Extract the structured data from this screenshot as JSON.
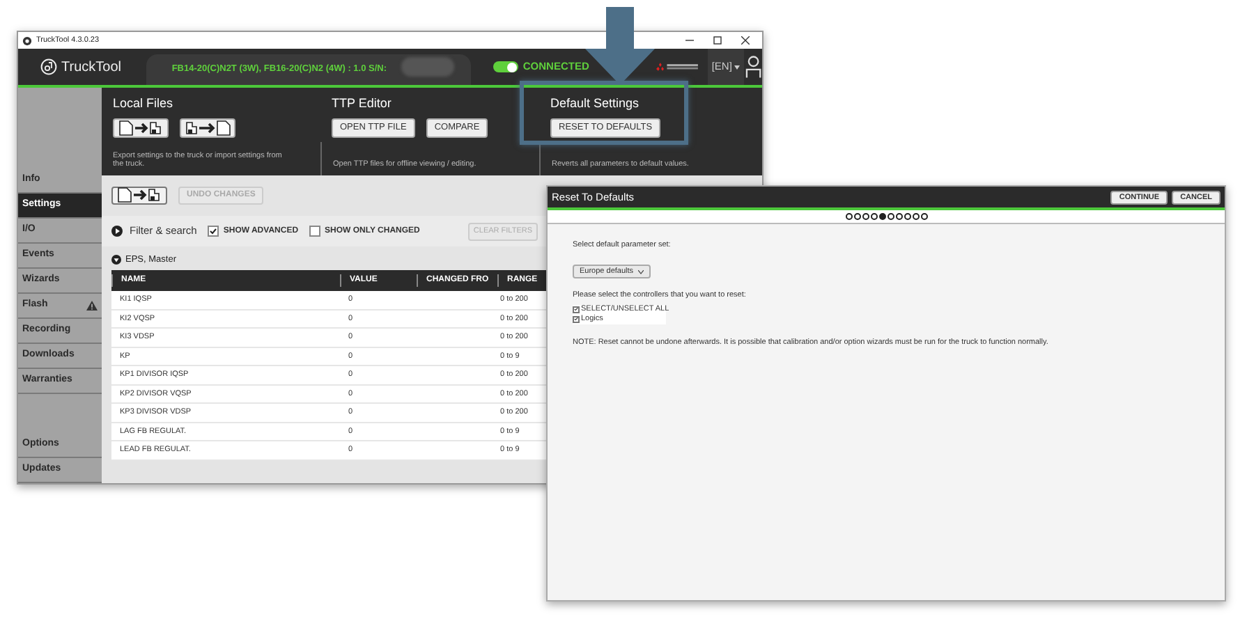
{
  "window": {
    "title": "TruckTool 4.3.0.23"
  },
  "header": {
    "app_name": "TruckTool",
    "model": "FB14-20(C)N2T (3W), FB16-20(C)N2 (4W) : 1.0  S/N:",
    "connection": {
      "on": true,
      "label": "CONNECTED"
    },
    "language": "[EN]"
  },
  "toolbar": {
    "sections": [
      {
        "title": "Local Files",
        "kind": "icons",
        "description": "Export settings to the truck or import settings from the truck.",
        "highlighted": false
      },
      {
        "title": "TTP Editor",
        "kind": "buttons",
        "buttons": [
          "OPEN TTP FILE",
          "COMPARE"
        ],
        "description": "Open TTP files for offline viewing / editing.",
        "highlighted": false
      },
      {
        "title": "Default Settings",
        "kind": "buttons",
        "buttons": [
          "RESET TO DEFAULTS"
        ],
        "description": "Reverts all parameters to default values.",
        "highlighted": true
      }
    ]
  },
  "sidebar": {
    "items": [
      {
        "label": "Info",
        "selected": false,
        "warning": false
      },
      {
        "label": "Settings",
        "selected": true,
        "warning": false
      },
      {
        "label": "I/O",
        "selected": false,
        "warning": false
      },
      {
        "label": "Events",
        "selected": false,
        "warning": false
      },
      {
        "label": "Wizards",
        "selected": false,
        "warning": false
      },
      {
        "label": "Flash",
        "selected": false,
        "warning": true
      },
      {
        "label": "Recording",
        "selected": false,
        "warning": false
      },
      {
        "label": "Downloads",
        "selected": false,
        "warning": false
      },
      {
        "label": "Warranties",
        "selected": false,
        "warning": false
      }
    ],
    "bottom_items": [
      {
        "label": "Options",
        "selected": false,
        "warning": false
      },
      {
        "label": "Updates",
        "selected": false,
        "warning": false
      }
    ]
  },
  "settings": {
    "undo_button": {
      "label": "UNDO CHANGES",
      "disabled": true
    },
    "filter": {
      "label": "Filter & search",
      "options": [
        {
          "label": "SHOW ADVANCED",
          "checked": true
        },
        {
          "label": "SHOW ONLY CHANGED",
          "checked": false
        }
      ],
      "clear_button": {
        "label": "CLEAR FILTERS",
        "disabled": true
      }
    },
    "group": {
      "title": "EPS, Master",
      "expanded": true
    },
    "table": {
      "columns": [
        "NAME",
        "VALUE",
        "CHANGED FRO",
        "RANGE"
      ],
      "rows": [
        {
          "name": "KI1  IQSP",
          "value": "0",
          "range": "0 to 200"
        },
        {
          "name": "KI2  VQSP",
          "value": "0",
          "range": "0 to 200"
        },
        {
          "name": "KI3  VDSP",
          "value": "0",
          "range": "0 to 200"
        },
        {
          "name": "KP",
          "value": "0",
          "range": "0 to 9"
        },
        {
          "name": "KP1 DIVISOR IQSP",
          "value": "0",
          "range": "0 to 200"
        },
        {
          "name": "KP2 DIVISOR VQSP",
          "value": "0",
          "range": "0 to 200"
        },
        {
          "name": "KP3 DIVISOR VDSP",
          "value": "0",
          "range": "0 to 200"
        },
        {
          "name": "LAG FB REGULAT.",
          "value": "0",
          "range": "0 to 9"
        },
        {
          "name": "LEAD FB REGULAT.",
          "value": "0",
          "range": "0 to 9"
        }
      ]
    }
  },
  "dialog": {
    "title": "Reset To Defaults",
    "buttons": [
      "CONTINUE",
      "CANCEL"
    ],
    "steps": [
      {
        "selected": false
      },
      {
        "selected": false
      },
      {
        "selected": false
      },
      {
        "selected": false
      },
      {
        "selected": true
      },
      {
        "selected": false
      },
      {
        "selected": false
      },
      {
        "selected": false
      },
      {
        "selected": false
      },
      {
        "selected": false
      }
    ],
    "parameter_label": "Select default parameter set:",
    "parameter_set": "Europe defaults",
    "controllers_label": "Please select the controllers that you want to reset:",
    "controllers": [
      {
        "label": "SELECT/UNSELECT ALL",
        "checked": true
      },
      {
        "label": "Logics",
        "checked": true
      }
    ],
    "note": "NOTE: Reset cannot be undone afterwards. It is possible that calibration and/or option wizards must be run for the truck to function normally."
  }
}
